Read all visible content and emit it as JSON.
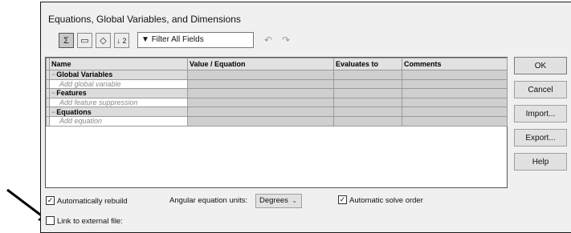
{
  "dialog": {
    "title": "Equations, Global Variables, and Dimensions"
  },
  "toolbar": {
    "filter_text": "Filter All Fields",
    "filter_icon": "funnel-icon",
    "sort_label": "↓ 2",
    "undo_icon": "undo-icon",
    "redo_icon": "redo-icon"
  },
  "table": {
    "headers": [
      "Name",
      "Value / Equation",
      "Evaluates to",
      "Comments"
    ],
    "groups": [
      {
        "label": "Global Variables",
        "add_label": "Add global variable"
      },
      {
        "label": "Features",
        "add_label": "Add feature suppression"
      },
      {
        "label": "Equations",
        "add_label": "Add equation"
      }
    ]
  },
  "buttons": {
    "ok": "OK",
    "cancel": "Cancel",
    "import": "Import...",
    "export": "Export...",
    "help": "Help"
  },
  "options": {
    "auto_rebuild": {
      "label": "Automatically rebuild",
      "checked": true
    },
    "angular_units_label": "Angular equation units:",
    "angular_units_value": "Degrees",
    "auto_solve": {
      "label": "Automatic solve order",
      "checked": true
    },
    "link_external": {
      "label": "Link to external file:",
      "checked": false
    }
  },
  "colors": {
    "dialog_bg": "#f0f0f0",
    "grid_grey": "#cfcfcf",
    "arrow": "#000000"
  }
}
